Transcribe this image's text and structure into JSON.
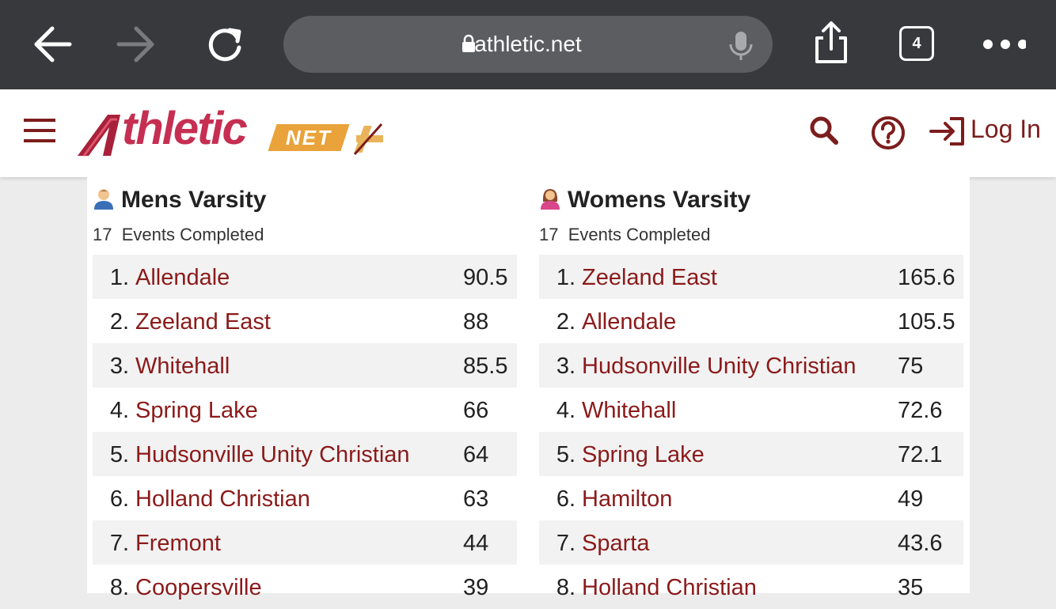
{
  "browser": {
    "url": "athletic.net",
    "tab_count": "4"
  },
  "site": {
    "logo_main": "thletic",
    "logo_net": "NET",
    "login_label": "Log In"
  },
  "mens": {
    "title": "Mens Varsity",
    "events_count": "17",
    "events_label": "Events Completed",
    "rows": [
      {
        "rank": "1.",
        "team": "Allendale",
        "score": "90.5"
      },
      {
        "rank": "2.",
        "team": "Zeeland East",
        "score": "88"
      },
      {
        "rank": "3.",
        "team": "Whitehall",
        "score": "85.5"
      },
      {
        "rank": "4.",
        "team": "Spring Lake",
        "score": "66"
      },
      {
        "rank": "5.",
        "team": "Hudsonville Unity Christian",
        "score": "64"
      },
      {
        "rank": "6.",
        "team": "Holland Christian",
        "score": "63"
      },
      {
        "rank": "7.",
        "team": "Fremont",
        "score": "44"
      },
      {
        "rank": "8.",
        "team": "Coopersville",
        "score": "39"
      }
    ]
  },
  "womens": {
    "title": "Womens Varsity",
    "events_count": "17",
    "events_label": "Events Completed",
    "rows": [
      {
        "rank": "1.",
        "team": "Zeeland East",
        "score": "165.6"
      },
      {
        "rank": "2.",
        "team": "Allendale",
        "score": "105.5"
      },
      {
        "rank": "3.",
        "team": "Hudsonville Unity Christian",
        "score": "75"
      },
      {
        "rank": "4.",
        "team": "Whitehall",
        "score": "72.6"
      },
      {
        "rank": "5.",
        "team": "Spring Lake",
        "score": "72.1"
      },
      {
        "rank": "6.",
        "team": "Hamilton",
        "score": "49"
      },
      {
        "rank": "7.",
        "team": "Sparta",
        "score": "43.6"
      },
      {
        "rank": "8.",
        "team": "Holland Christian",
        "score": "35"
      }
    ]
  },
  "colors": {
    "chrome_bg": "#38393c",
    "brand_maroon": "#7c1d1d",
    "team_link": "#8b1a1a",
    "row_stripe": "#f2f2f2"
  }
}
